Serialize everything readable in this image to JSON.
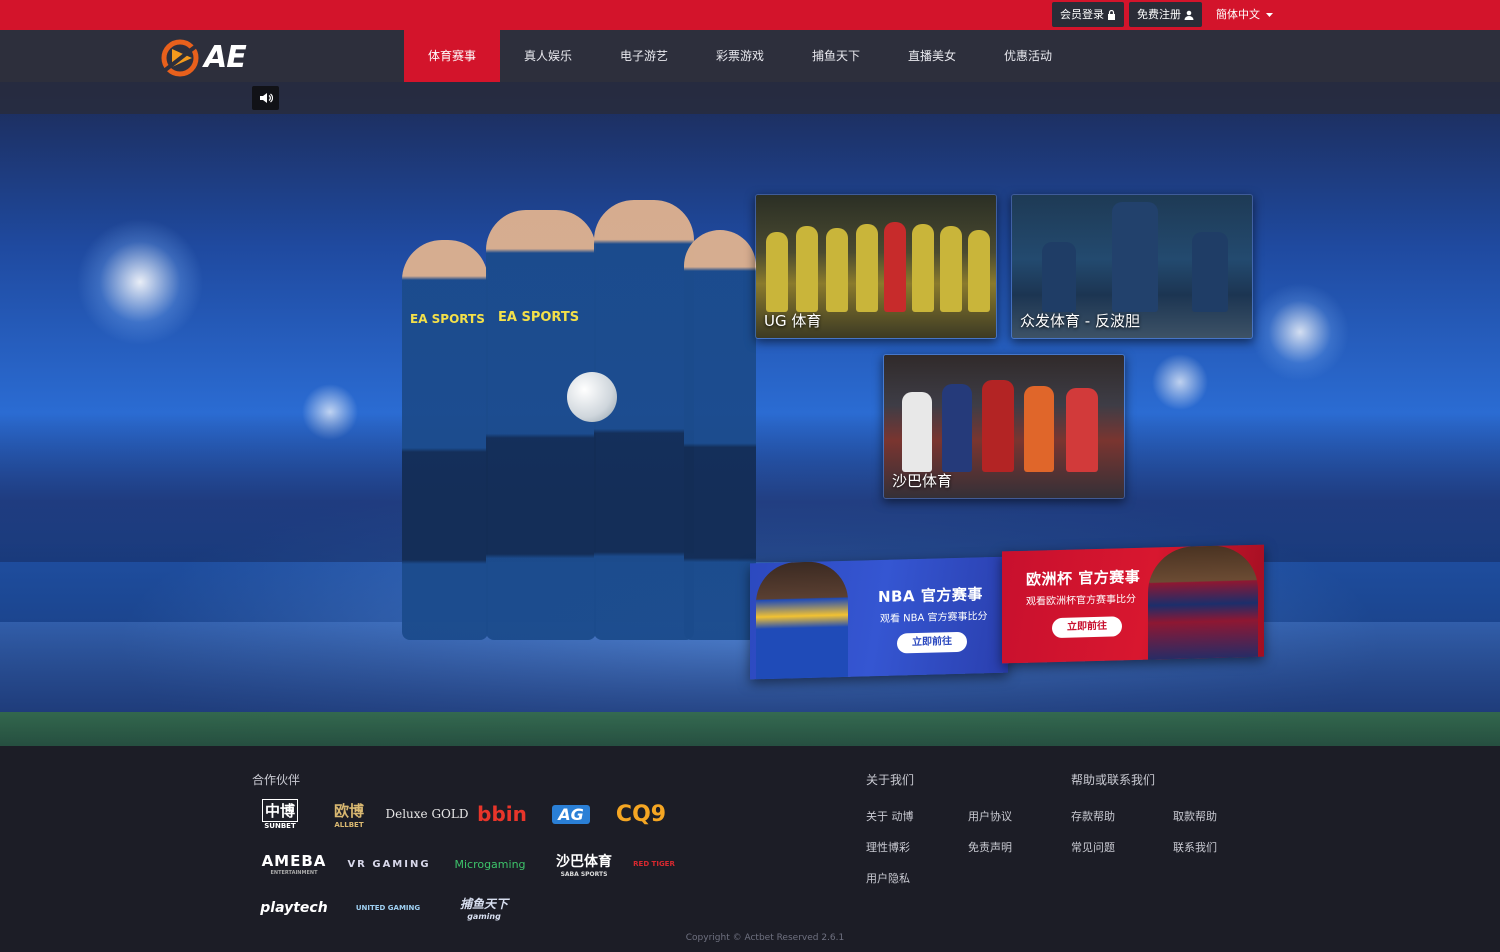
{
  "topbar": {
    "login_label": "会员登录",
    "register_label": "免费注册",
    "language_label": "簡体中文"
  },
  "brand": {
    "logo_text": "AE"
  },
  "nav": {
    "items": [
      {
        "label": "体育赛事"
      },
      {
        "label": "真人娱乐"
      },
      {
        "label": "电子游艺"
      },
      {
        "label": "彩票游戏"
      },
      {
        "label": "捕鱼天下"
      },
      {
        "label": "直播美女"
      },
      {
        "label": "优惠活动"
      }
    ]
  },
  "hero": {
    "jersey_text": "EA SPORTS",
    "cards": [
      {
        "label": "UG 体育"
      },
      {
        "label": "众发体育 - 反波胆"
      },
      {
        "label": "沙巴体育"
      }
    ],
    "promos": {
      "nba": {
        "title": "NBA 官方赛事",
        "subtitle": "观看 NBA 官方赛事比分",
        "button": "立即前往"
      },
      "euro": {
        "title": "欧洲杯 官方赛事",
        "subtitle": "观看欧洲杯官方赛事比分",
        "button": "立即前往"
      }
    }
  },
  "footer": {
    "partners_heading": "合作伙伴",
    "partners": [
      {
        "name": "中博",
        "sub": "SUNBET"
      },
      {
        "name": "欧博",
        "sub": "ALLBET"
      },
      {
        "name": "Deluxe GOLD"
      },
      {
        "name": "bbin"
      },
      {
        "name": "AG"
      },
      {
        "name": "CQ9"
      },
      {
        "name": "AMEBA",
        "sub": "ENTERTAINMENT"
      },
      {
        "name": "VR GAMING"
      },
      {
        "name": "Microgaming"
      },
      {
        "name": "沙巴体育",
        "sub": "SABA SPORTS"
      },
      {
        "name": "RED TIGER"
      },
      {
        "name": "playtech"
      },
      {
        "name": "UNITED GAMING"
      },
      {
        "name": "捕鱼天下",
        "sub": "gaming"
      }
    ],
    "about_heading": "关于我们",
    "about_links": [
      {
        "label": "关于 动博"
      },
      {
        "label": "用户协议"
      },
      {
        "label": "理性博彩"
      },
      {
        "label": "免责声明"
      },
      {
        "label": "用户隐私"
      }
    ],
    "help_heading": "帮助或联系我们",
    "help_links": [
      {
        "label": "存款帮助"
      },
      {
        "label": "取款帮助"
      },
      {
        "label": "常见问题"
      },
      {
        "label": "联系我们"
      }
    ],
    "copyright": "Copyright © Actbet Reserved   2.6.1"
  },
  "colors": {
    "accent": "#d3142b",
    "nav_bg": "#2d2f3c",
    "footer_bg": "#1c1d26"
  }
}
